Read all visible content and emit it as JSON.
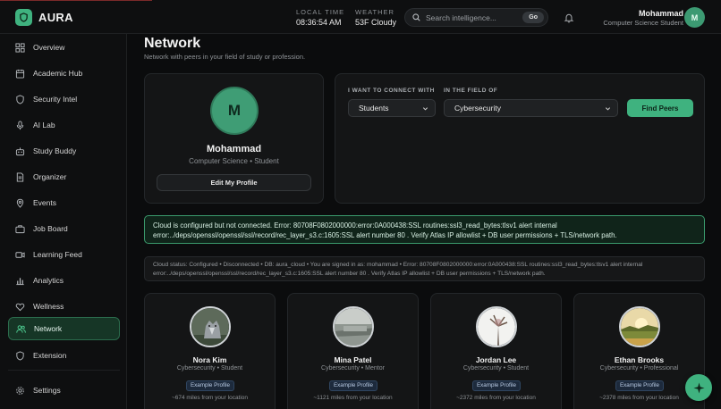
{
  "app": {
    "name": "AURA"
  },
  "header": {
    "local_time_label": "LOCAL TIME",
    "local_time_value": "08:36:54 AM",
    "weather_label": "WEATHER",
    "weather_value": "53F Cloudy",
    "search_placeholder": "Search intelligence...",
    "search_go": "Go",
    "user_name": "Mohammad",
    "user_role": "Computer Science Student",
    "user_initial": "M"
  },
  "sidebar": {
    "items": [
      {
        "label": "Overview",
        "icon": "grid-icon"
      },
      {
        "label": "Academic Hub",
        "icon": "calendar-icon"
      },
      {
        "label": "Security Intel",
        "icon": "shield-icon"
      },
      {
        "label": "AI Lab",
        "icon": "microphone-icon"
      },
      {
        "label": "Study Buddy",
        "icon": "robot-icon"
      },
      {
        "label": "Organizer",
        "icon": "document-icon"
      },
      {
        "label": "Events",
        "icon": "map-pin-icon"
      },
      {
        "label": "Job Board",
        "icon": "briefcase-icon"
      },
      {
        "label": "Learning Feed",
        "icon": "video-icon"
      },
      {
        "label": "Analytics",
        "icon": "bar-chart-icon"
      },
      {
        "label": "Wellness",
        "icon": "heart-icon"
      },
      {
        "label": "Network",
        "icon": "users-icon",
        "active": true
      },
      {
        "label": "Extension",
        "icon": "shield-icon"
      }
    ],
    "settings_label": "Settings"
  },
  "main": {
    "title": "Network",
    "subtitle": "Network with peers in your field of study or profession.",
    "profile": {
      "initial": "M",
      "name": "Mohammad",
      "role": "Computer Science • Student",
      "edit_label": "Edit My Profile"
    },
    "connect": {
      "connect_label": "I WANT TO CONNECT WITH",
      "connect_value": "Students",
      "field_label": "IN THE FIELD OF",
      "field_value": "Cybersecurity",
      "find_label": "Find Peers"
    },
    "alert_text": "Cloud is configured but not connected. Error: 80708F0802000000:error:0A000438:SSL routines:ssl3_read_bytes:tlsv1 alert internal error:../deps/openssl/openssl/ssl/record/rec_layer_s3.c:1605:SSL alert number 80 . Verify Atlas IP allowlist + DB user permissions + TLS/network path.",
    "status_text": "Cloud status: Configured • Disconnected • DB: aura_cloud • You are signed in as: mohammad • Error: 80708F0802000000:error:0A000438:SSL routines:ssl3_read_bytes:tlsv1 alert internal error:../deps/openssl/openssl/ssl/record/rec_layer_s3.c:1605:SSL alert number 80 . Verify Atlas IP allowlist + DB user permissions + TLS/network path.",
    "peers": [
      {
        "name": "Nora Kim",
        "role": "Cybersecurity • Student",
        "badge": "Example Profile",
        "distance": "~674 miles from your location"
      },
      {
        "name": "Mina Patel",
        "role": "Cybersecurity • Mentor",
        "badge": "Example Profile",
        "distance": "~1121 miles from your location"
      },
      {
        "name": "Jordan Lee",
        "role": "Cybersecurity • Student",
        "badge": "Example Profile",
        "distance": "~2372 miles from your location"
      },
      {
        "name": "Ethan Brooks",
        "role": "Cybersecurity • Professional",
        "badge": "Example Profile",
        "distance": "~2378 miles from your location"
      }
    ]
  },
  "colors": {
    "accent": "#3fb27f",
    "alert_border": "#3a9a6c"
  }
}
